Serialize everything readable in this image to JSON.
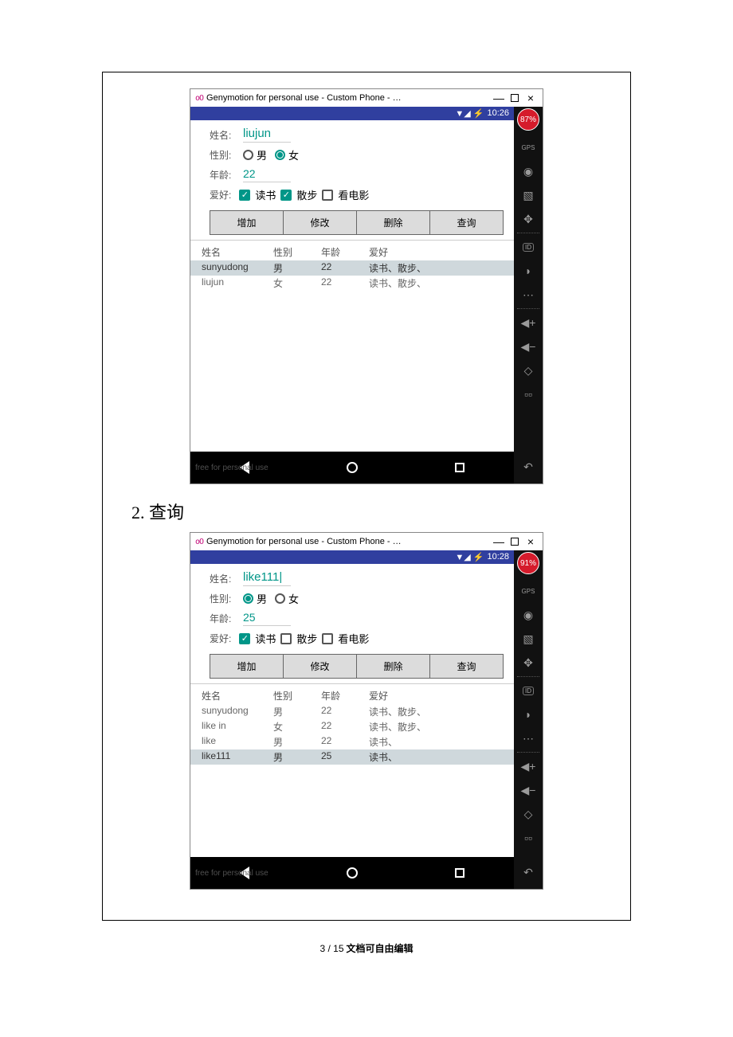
{
  "sec": {
    "heading_label": "2. 查询"
  },
  "win": {
    "title": "Genymotion for personal use - Custom Phone - …",
    "minimize": "—",
    "close": "×"
  },
  "status": {
    "icons": "▼◢ ⚡",
    "time1": "10:26",
    "time2": "10:28"
  },
  "battery": {
    "s1": "87%",
    "s2": "91%"
  },
  "side": {
    "gps": "GPS",
    "webcam": "◉",
    "clap": "▧",
    "move": "✥",
    "id": "ID",
    "net": "◗",
    "more": "⋯",
    "vplus": "◀+",
    "vminus": "◀−",
    "rotate": "◇",
    "px": "▫▫",
    "back": "↶"
  },
  "labels": {
    "name": "姓名:",
    "gender": "性别:",
    "age": "年龄:",
    "hobby": "爱好:",
    "male": "男",
    "female": "女",
    "read": "读书",
    "walk": "散步",
    "movie": "看电影",
    "btn_add": "增加",
    "btn_edit": "修改",
    "btn_del": "删除",
    "btn_query": "查询",
    "col_name": "姓名",
    "col_gender": "性别",
    "col_age": "年龄",
    "col_hobby": "爱好",
    "free": "free for personal use"
  },
  "s1": {
    "name": "liujun",
    "age": "22",
    "gender_selected": "female",
    "hobby": {
      "read": true,
      "walk": true,
      "movie": false
    },
    "rows": [
      {
        "name": "sunyudong",
        "gender": "男",
        "age": "22",
        "hobby": "读书、散步、",
        "sel": true
      },
      {
        "name": "liujun",
        "gender": "女",
        "age": "22",
        "hobby": "读书、散步、",
        "sel": false
      }
    ]
  },
  "s2": {
    "name": "like111",
    "age": "25",
    "gender_selected": "male",
    "hobby": {
      "read": true,
      "walk": false,
      "movie": false
    },
    "rows": [
      {
        "name": "sunyudong",
        "gender": "男",
        "age": "22",
        "hobby": "读书、散步、",
        "sel": false
      },
      {
        "name": "like in",
        "gender": "女",
        "age": "22",
        "hobby": "读书、散步、",
        "sel": false
      },
      {
        "name": "like",
        "gender": "男",
        "age": "22",
        "hobby": "读书、",
        "sel": false
      },
      {
        "name": "like111",
        "gender": "男",
        "age": "25",
        "hobby": "读书、",
        "sel": true
      }
    ]
  },
  "footer": {
    "page_current": "3",
    "page_sep": " / ",
    "page_total": "15",
    "note": " 文档可自由编辑"
  }
}
